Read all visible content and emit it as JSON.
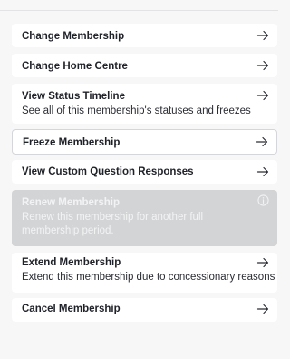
{
  "menu": {
    "items": [
      {
        "title": "Change Membership",
        "description": "",
        "icon": "arrow-right-icon"
      },
      {
        "title": "Change Home Centre",
        "description": "",
        "icon": "arrow-right-icon"
      },
      {
        "title": "View Status Timeline",
        "description": "See all of this membership's statuses and freezes",
        "icon": "arrow-right-icon"
      },
      {
        "title": "Freeze Membership",
        "description": "",
        "icon": "arrow-right-icon"
      },
      {
        "title": "View Custom Question Responses",
        "description": "",
        "icon": "arrow-right-icon"
      },
      {
        "title": "Renew Membership",
        "description": "Renew this membership for another full membership period.",
        "icon": "info-icon",
        "disabled": true
      },
      {
        "title": "Extend Membership",
        "description": "Extend this membership due to concessionary reasons",
        "icon": "arrow-right-icon"
      },
      {
        "title": "Cancel Membership",
        "description": "",
        "icon": "arrow-right-icon"
      }
    ]
  },
  "colors": {
    "background": "#f7f7f8",
    "card": "#ffffff",
    "disabled_card": "#d3d4d6",
    "text": "#1f2128"
  }
}
